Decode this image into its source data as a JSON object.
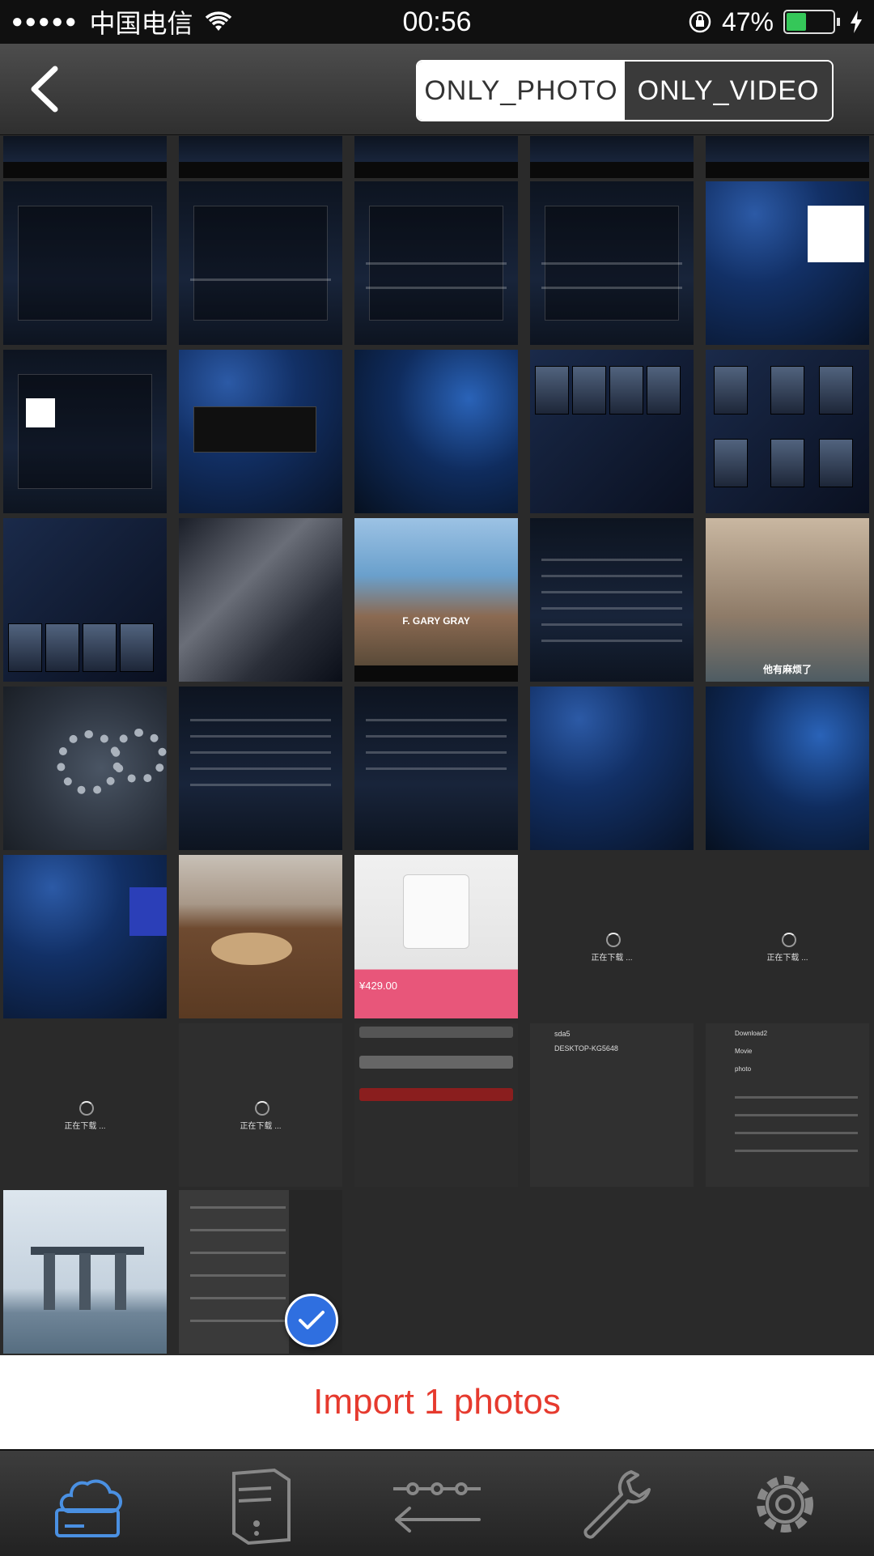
{
  "status_bar": {
    "signal": "●●●●●",
    "carrier": "中国电信",
    "time": "00:56",
    "battery_percent": "47%",
    "battery_level": 0.47
  },
  "header": {
    "segments": [
      "ONLY_PHOTO",
      "ONLY_VIDEO"
    ],
    "selected_segment": "ONLY_PHOTO"
  },
  "grid": {
    "loading_label": "正在下载 ...",
    "tile_texts": {
      "downloading_1": "正在下载 ...",
      "downloading_2": "正在下载 ...",
      "downloading_3": "正在下载 ...",
      "downloading_4": "正在下载 ...",
      "product_price": "¥429.00",
      "car_caption": "F. GARY GRAY",
      "people_caption": "他有麻烦了",
      "file_store_1": "sda5",
      "file_store_2": "DESKTOP-KG5648",
      "files_1": "Download2",
      "files_2": "Movie",
      "files_3": "photo"
    },
    "selected_count": 1
  },
  "import": {
    "label": "Import 1 photos"
  },
  "tabbar": {
    "tabs": [
      "cloud-drive",
      "server",
      "transfer",
      "tools",
      "settings"
    ]
  },
  "colors": {
    "accent_red": "#e63a2e",
    "select_blue": "#2f6fe0",
    "battery_green": "#35c759"
  }
}
